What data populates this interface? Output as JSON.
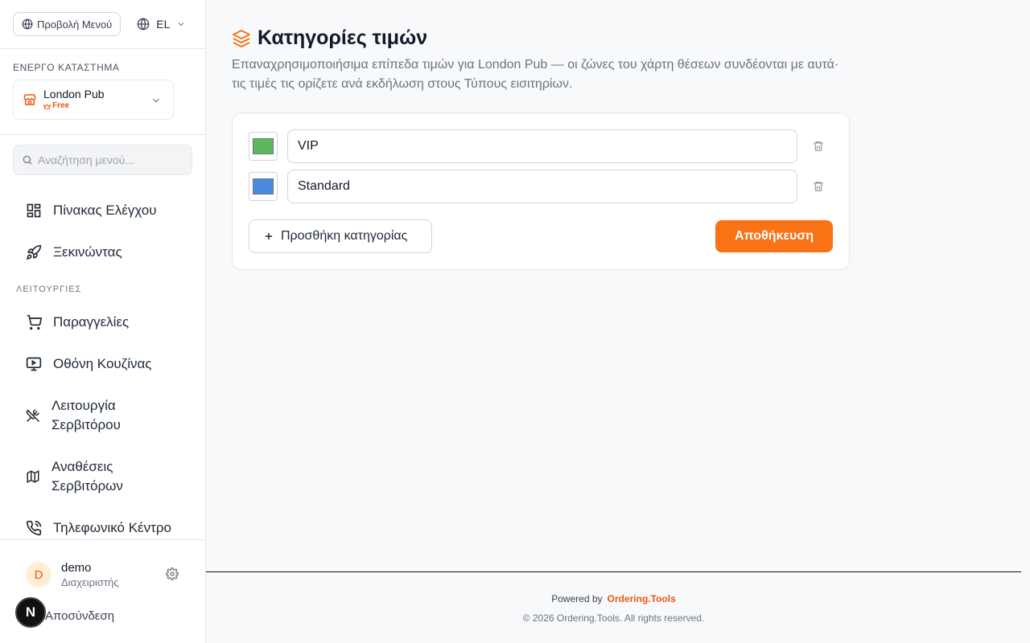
{
  "sidebar": {
    "menu_view_label": "Προβολή Μενού",
    "language": "EL",
    "active_store_label": "ΕΝΕΡΓΟ ΚΑΤΑΣΤΗΜΑ",
    "store_name": "London Pub",
    "store_plan": "Free",
    "search_placeholder": "Αναζήτηση μενού...",
    "items": [
      {
        "label": "Πίνακας Ελέγχου",
        "icon": "dashboard-icon"
      },
      {
        "label": "Ξεκινώντας",
        "icon": "rocket-icon"
      }
    ],
    "group_label": "ΛΕΙΤΟΥΡΓΙΕΣ",
    "group_items": [
      {
        "label": "Παραγγελίες",
        "icon": "cart-icon"
      },
      {
        "label": "Οθόνη Κουζίνας",
        "icon": "monitor-play-icon"
      },
      {
        "label_line1": "Λειτουργία",
        "label_line2": "Σερβιτόρου",
        "icon": "utensils-crossed-icon"
      },
      {
        "label_line1": "Αναθέσεις",
        "label_line2": "Σερβιτόρων",
        "icon": "map-icon"
      },
      {
        "label": "Τηλεφωνικό Κέντρο",
        "icon": "phone-call-icon"
      }
    ],
    "user": {
      "initial": "D",
      "name": "demo",
      "role": "Διαχειριστής"
    },
    "logout_label": "Αποσύνδεση",
    "badge_letter": "N"
  },
  "main": {
    "title": "Κατηγορίες τιμών",
    "subtitle": "Επαναχρησιμοποιήσιμα επίπεδα τιμών για London Pub — οι ζώνες του χάρτη θέσεων συνδέονται με αυτά· τις τιμές τις ορίζετε ανά εκδήλωση στους Τύπους εισιτηρίων.",
    "categories": [
      {
        "name": "VIP",
        "color": "#5cb85c"
      },
      {
        "name": "Standard",
        "color": "#4a89dc"
      }
    ],
    "add_label": "Προσθήκη κατηγορίας",
    "save_label": "Αποθήκευση"
  },
  "footer": {
    "powered_by": "Powered by",
    "brand": "Ordering.Tools",
    "copyright": "© 2026 Ordering.Tools. All rights reserved."
  },
  "colors": {
    "accent": "#f97316"
  }
}
